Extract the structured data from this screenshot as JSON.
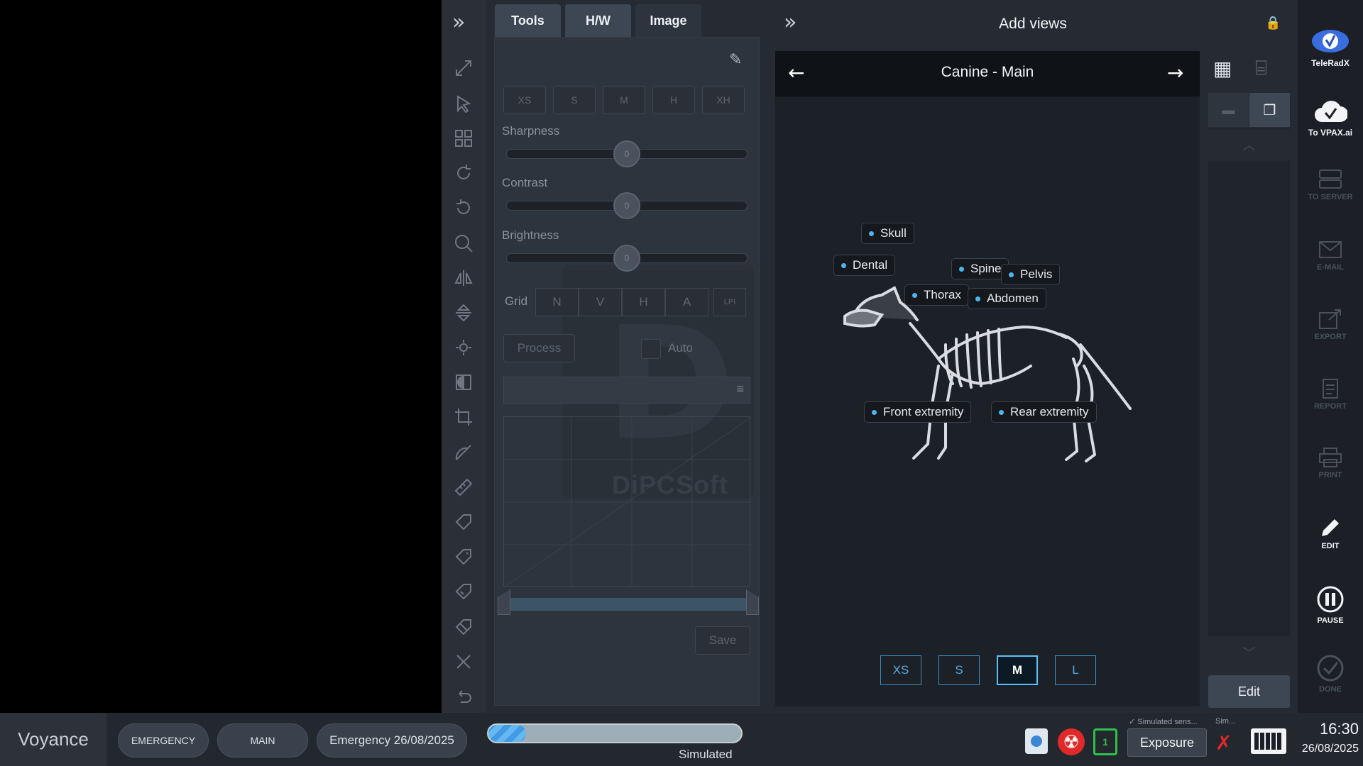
{
  "header": {
    "title": "Add views"
  },
  "tabs": [
    {
      "label": "Tools"
    },
    {
      "label": "H/W"
    },
    {
      "label": "Image"
    }
  ],
  "image_panel": {
    "size_buttons": [
      "XS",
      "S",
      "M",
      "H",
      "XH"
    ],
    "sliders": [
      {
        "label": "Sharpness",
        "value": "0"
      },
      {
        "label": "Contrast",
        "value": "0"
      },
      {
        "label": "Brightness",
        "value": "0"
      }
    ],
    "grid_label": "Grid",
    "grid_buttons": [
      "N",
      "V",
      "H",
      "A"
    ],
    "lpi_label": "LPI",
    "process_label": "Process",
    "auto_label": "Auto",
    "save_label": "Save",
    "watermark": "DiPCSoft"
  },
  "views": {
    "nav_title": "Canine - Main",
    "body_parts": [
      "Skull",
      "Dental",
      "Spine",
      "Pelvis",
      "Thorax",
      "Abdomen",
      "Front extremity",
      "Rear extremity"
    ],
    "sizes": [
      "XS",
      "S",
      "M",
      "L"
    ],
    "selected_size": "M",
    "edit_label": "Edit"
  },
  "right_bar": {
    "teleradx": "TeleRadX",
    "vpax": "To VPAX.ai",
    "to_server": "TO SERVER",
    "email": "E-MAIL",
    "export": "EXPORT",
    "report": "REPORT",
    "print": "PRINT",
    "edit": "EDIT",
    "pause": "PAUSE",
    "done": "DONE"
  },
  "status": {
    "brand": "Voyance",
    "emergency": "EMERGENCY",
    "main": "MAIN",
    "study": "Emergency 26/08/2025",
    "progress_fraction": 0.15,
    "progress_caption": "Simulated",
    "simulated_sensor": "Simulated sens...",
    "simulated_short": "Sim...",
    "exposure": "Exposure",
    "time": "16:30",
    "date": "26/08/2025"
  },
  "colors": {
    "accent": "#4fb5f0",
    "panel": "#2e343d",
    "background": "#262b33"
  }
}
